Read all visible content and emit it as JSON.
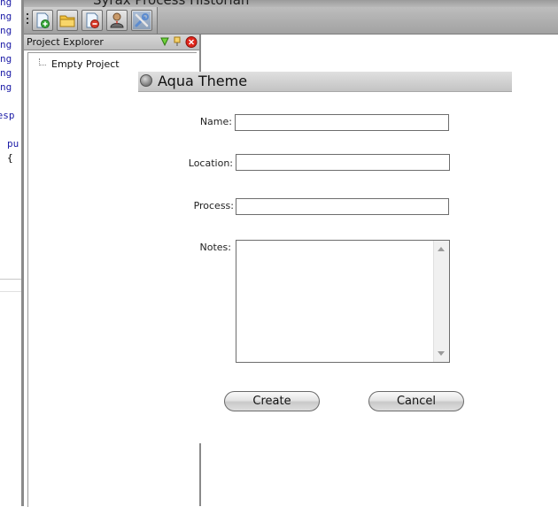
{
  "app": {
    "title": "Syrax Process Historian"
  },
  "code_strip": {
    "lines": [
      "ng",
      "ng",
      "ng",
      "ng",
      "ng",
      "ng",
      "ng",
      "nesp",
      "pu",
      "{"
    ]
  },
  "toolbar": {
    "buttons": [
      {
        "icon": "new-project-icon"
      },
      {
        "icon": "open-folder-icon"
      },
      {
        "icon": "remove-project-icon"
      },
      {
        "icon": "user-icon"
      },
      {
        "icon": "tools-icon"
      }
    ]
  },
  "explorer": {
    "title": "Project Explorer",
    "tree": [
      {
        "label": "Empty Project"
      }
    ]
  },
  "dialog": {
    "title": "Aqua Theme",
    "fields": {
      "name": {
        "label": "Name:",
        "value": ""
      },
      "location": {
        "label": "Location:",
        "value": ""
      },
      "process": {
        "label": "Process:",
        "value": ""
      },
      "notes": {
        "label": "Notes:",
        "value": ""
      }
    },
    "buttons": {
      "create": "Create",
      "cancel": "Cancel"
    }
  },
  "colors": {
    "code_keyword": "#1a1aa6",
    "toolbar_bg": "#a8a8a8",
    "close_red": "#e0261b",
    "filter_green": "#4caf1a"
  }
}
